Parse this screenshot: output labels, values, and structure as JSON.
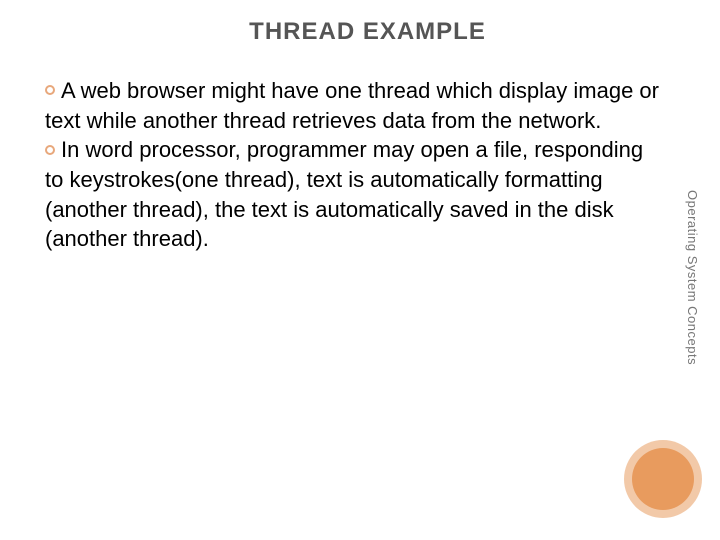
{
  "title": "THREAD EXAMPLE",
  "bullets": [
    "A web browser might have one thread which display image or text while another thread retrieves data from the network.",
    "In word processor, programmer may open a file, responding to keystrokes(one thread), text is automatically formatting (another thread), the text is automatically saved in the disk (another thread)."
  ],
  "side_label": "Operating System Concepts"
}
